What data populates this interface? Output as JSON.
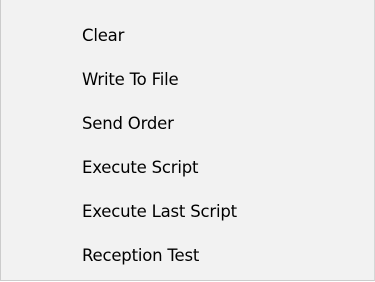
{
  "context_menu": {
    "items": [
      {
        "label": "Clear"
      },
      {
        "label": "Write To File"
      },
      {
        "label": "Send Order"
      },
      {
        "label": "Execute Script"
      },
      {
        "label": "Execute Last Script"
      },
      {
        "label": "Reception Test"
      }
    ]
  }
}
